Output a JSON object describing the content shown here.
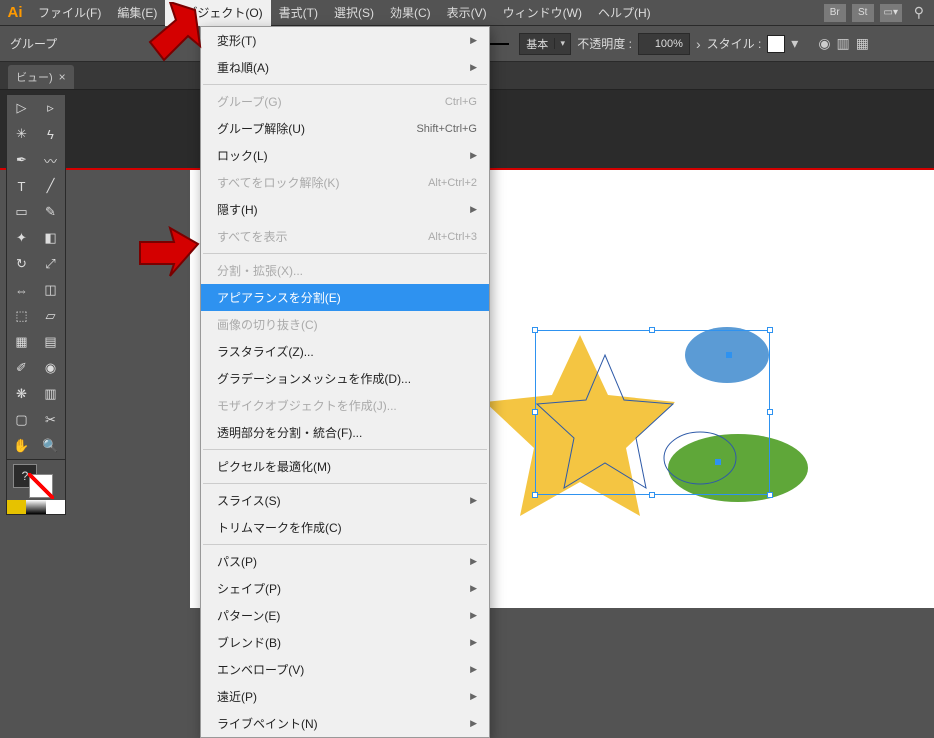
{
  "app": {
    "logo": "Ai"
  },
  "menubar": {
    "items": [
      "ファイル(F)",
      "編集(E)",
      "オブジェクト(O)",
      "書式(T)",
      "選択(S)",
      "効果(C)",
      "表示(V)",
      "ウィンドウ(W)",
      "ヘルプ(H)"
    ],
    "active_index": 2,
    "right_btns": [
      "Br",
      "St"
    ]
  },
  "controlbar": {
    "selection_label": "グループ",
    "basic_label": "基本",
    "opacity_label": "不透明度 :",
    "opacity_value": "100%",
    "style_label": "スタイル :"
  },
  "doctab": {
    "title": "ビュー)",
    "close": "×"
  },
  "dropdown": {
    "items": [
      {
        "label": "変形(T)",
        "sub": true
      },
      {
        "label": "重ね順(A)",
        "sub": true
      },
      {
        "sep": true
      },
      {
        "label": "グループ(G)",
        "shortcut": "Ctrl+G",
        "disabled": true
      },
      {
        "label": "グループ解除(U)",
        "shortcut": "Shift+Ctrl+G"
      },
      {
        "label": "ロック(L)",
        "sub": true
      },
      {
        "label": "すべてをロック解除(K)",
        "shortcut": "Alt+Ctrl+2",
        "disabled": true
      },
      {
        "label": "隠す(H)",
        "sub": true
      },
      {
        "label": "すべてを表示",
        "shortcut": "Alt+Ctrl+3",
        "disabled": true
      },
      {
        "sep": true
      },
      {
        "label": "分割・拡張(X)...",
        "disabled": true
      },
      {
        "label": "アピアランスを分割(E)",
        "highlight": true
      },
      {
        "label": "画像の切り抜き(C)",
        "disabled": true
      },
      {
        "label": "ラスタライズ(Z)..."
      },
      {
        "label": "グラデーションメッシュを作成(D)..."
      },
      {
        "label": "モザイクオブジェクトを作成(J)...",
        "disabled": true
      },
      {
        "label": "透明部分を分割・統合(F)..."
      },
      {
        "sep": true
      },
      {
        "label": "ピクセルを最適化(M)"
      },
      {
        "sep": true
      },
      {
        "label": "スライス(S)",
        "sub": true
      },
      {
        "label": "トリムマークを作成(C)"
      },
      {
        "sep": true
      },
      {
        "label": "パス(P)",
        "sub": true
      },
      {
        "label": "シェイプ(P)",
        "sub": true
      },
      {
        "label": "パターン(E)",
        "sub": true
      },
      {
        "label": "ブレンド(B)",
        "sub": true
      },
      {
        "label": "エンベロープ(V)",
        "sub": true
      },
      {
        "label": "遠近(P)",
        "sub": true
      },
      {
        "label": "ライブペイント(N)",
        "sub": true
      }
    ]
  }
}
